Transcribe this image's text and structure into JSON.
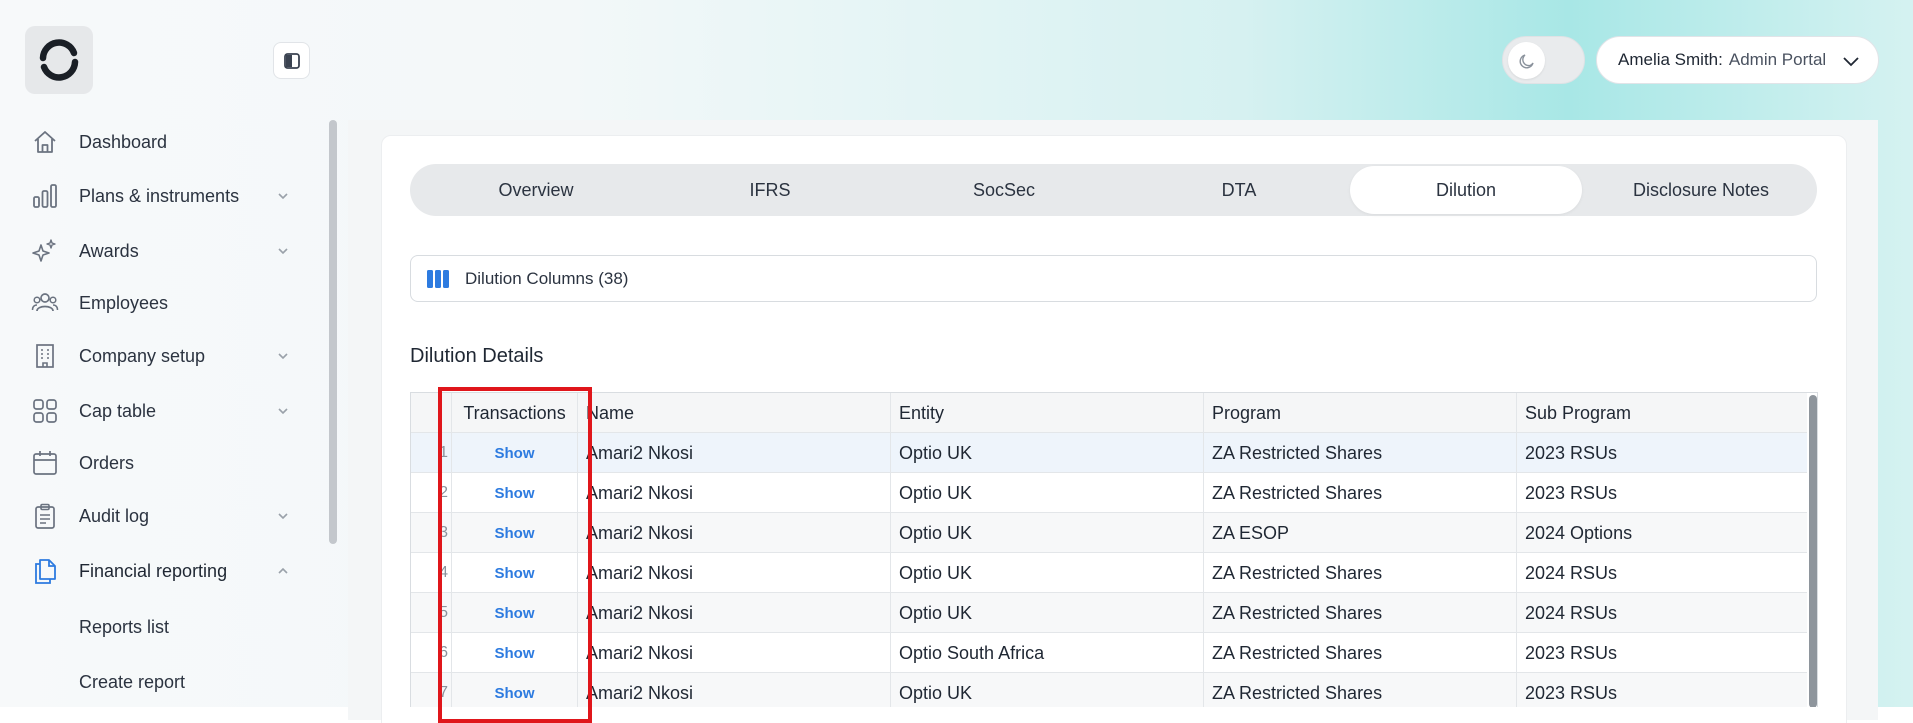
{
  "header": {
    "user_name": "Amelia Smith:",
    "user_role": "Admin Portal"
  },
  "sidebar": {
    "items": [
      {
        "label": "Dashboard",
        "icon": "home-icon"
      },
      {
        "label": "Plans & instruments",
        "icon": "bar-chart-icon"
      },
      {
        "label": "Awards",
        "icon": "sparkles-icon"
      },
      {
        "label": "Employees",
        "icon": "users-icon"
      },
      {
        "label": "Company setup",
        "icon": "building-icon"
      },
      {
        "label": "Cap table",
        "icon": "grid-icon"
      },
      {
        "label": "Orders",
        "icon": "calendar-icon"
      },
      {
        "label": "Audit log",
        "icon": "clipboard-icon"
      },
      {
        "label": "Financial reporting",
        "icon": "documents-icon"
      }
    ],
    "sub_items": [
      "Reports list",
      "Create report"
    ]
  },
  "tabs": [
    "Overview",
    "IFRS",
    "SocSec",
    "DTA",
    "Dilution",
    "Disclosure Notes"
  ],
  "active_tab": "Dilution",
  "columns_button": "Dilution Columns (38)",
  "section_title": "Dilution Details",
  "table": {
    "headers": [
      "Transactions",
      "Name",
      "Entity",
      "Program",
      "Sub Program"
    ],
    "show_label": "Show",
    "rows": [
      {
        "num": "1",
        "name": "Amari2 Nkosi",
        "entity": "Optio UK",
        "program": "ZA Restricted Shares",
        "sub": "2023 RSUs"
      },
      {
        "num": "2",
        "name": "Amari2 Nkosi",
        "entity": "Optio UK",
        "program": "ZA Restricted Shares",
        "sub": "2023 RSUs"
      },
      {
        "num": "3",
        "name": "Amari2 Nkosi",
        "entity": "Optio UK",
        "program": "ZA ESOP",
        "sub": "2024 Options"
      },
      {
        "num": "4",
        "name": "Amari2 Nkosi",
        "entity": "Optio UK",
        "program": "ZA Restricted Shares",
        "sub": "2024 RSUs"
      },
      {
        "num": "5",
        "name": "Amari2 Nkosi",
        "entity": "Optio UK",
        "program": "ZA Restricted Shares",
        "sub": "2024 RSUs"
      },
      {
        "num": "6",
        "name": "Amari2 Nkosi",
        "entity": "Optio South Africa",
        "program": "ZA Restricted Shares",
        "sub": "2023 RSUs"
      },
      {
        "num": "7",
        "name": "Amari2 Nkosi",
        "entity": "Optio UK",
        "program": "ZA Restricted Shares",
        "sub": "2023 RSUs"
      }
    ]
  },
  "colors": {
    "accent": "#2d7be0",
    "highlight": "#e0161b"
  }
}
